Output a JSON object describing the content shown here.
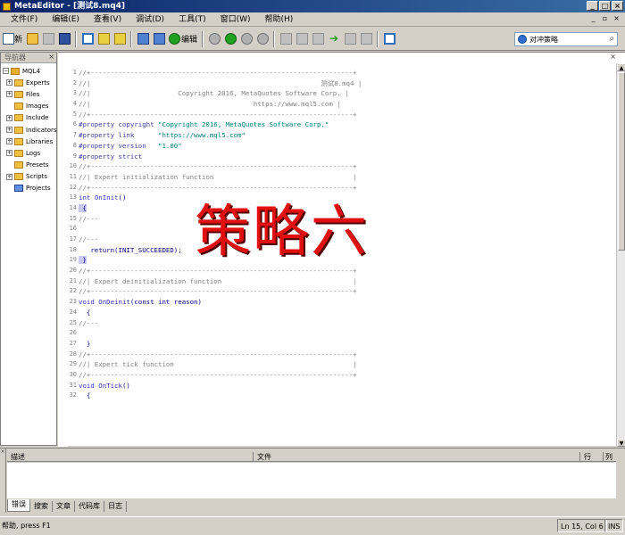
{
  "window": {
    "title": "MetaEditor - [测试8.mq4]"
  },
  "menu": [
    "文件(F)",
    "编辑(E)",
    "查看(V)",
    "调试(D)",
    "工具(T)",
    "窗口(W)",
    "帮助(H)"
  ],
  "toolbar": {
    "new_label": "新",
    "compile_label": "编辑",
    "search_value": "对冲策略"
  },
  "navigator": {
    "header": "导航器",
    "root": "MQL4",
    "items": [
      {
        "label": "Experts",
        "expandable": true
      },
      {
        "label": "Files",
        "expandable": true
      },
      {
        "label": "Images",
        "expandable": false
      },
      {
        "label": "Include",
        "expandable": true
      },
      {
        "label": "Indicators",
        "expandable": true
      },
      {
        "label": "Libraries",
        "expandable": true
      },
      {
        "label": "Logs",
        "expandable": true
      },
      {
        "label": "Presets",
        "expandable": false
      },
      {
        "label": "Scripts",
        "expandable": true
      },
      {
        "label": "Projects",
        "expandable": false
      }
    ]
  },
  "editor": {
    "lines": [
      {
        "n": "1",
        "segs": [
          [
            "c-comment",
            "//+------------------------------------------------------------------+"
          ]
        ]
      },
      {
        "n": "2",
        "segs": [
          [
            "c-comment",
            "//|                                                          测试8.mq4 |"
          ]
        ]
      },
      {
        "n": "3",
        "segs": [
          [
            "c-comment",
            "//|                      Copyright 2016, MetaQuotes Software Corp. |"
          ]
        ]
      },
      {
        "n": "4",
        "segs": [
          [
            "c-comment",
            "//|                                         https://www.mql5.com |"
          ]
        ]
      },
      {
        "n": "5",
        "segs": [
          [
            "c-comment",
            "//+------------------------------------------------------------------+"
          ]
        ]
      },
      {
        "n": "6",
        "segs": [
          [
            "c-pp",
            "#property copyright "
          ],
          [
            "c-str",
            "\"Copyright 2016, MetaQuotes Software Corp.\""
          ]
        ]
      },
      {
        "n": "7",
        "segs": [
          [
            "c-pp",
            "#property link      "
          ],
          [
            "c-str",
            "\"https://www.mql5.com\""
          ]
        ]
      },
      {
        "n": "8",
        "segs": [
          [
            "c-pp",
            "#property version   "
          ],
          [
            "c-str",
            "\"1.00\""
          ]
        ]
      },
      {
        "n": "9",
        "segs": [
          [
            "c-pp",
            "#property strict"
          ]
        ]
      },
      {
        "n": "10",
        "segs": [
          [
            "c-comment",
            "//+------------------------------------------------------------------+"
          ]
        ]
      },
      {
        "n": "11",
        "segs": [
          [
            "c-comment",
            "//| Expert initialization function                                   |"
          ]
        ]
      },
      {
        "n": "12",
        "segs": [
          [
            "c-comment",
            "//+------------------------------------------------------------------+"
          ]
        ]
      },
      {
        "n": "13",
        "segs": [
          [
            "c-kw",
            "int "
          ],
          [
            "c-fn",
            "OnInit"
          ],
          [
            "c-norm",
            "()"
          ]
        ]
      },
      {
        "n": "14",
        "segs": [
          [
            "c-brace bm",
            " {"
          ]
        ]
      },
      {
        "n": "15",
        "segs": [
          [
            "c-comment",
            "//---"
          ]
        ]
      },
      {
        "n": "16",
        "segs": [
          [
            "c-comment",
            ""
          ]
        ]
      },
      {
        "n": "17",
        "segs": [
          [
            "c-comment",
            "//---"
          ]
        ]
      },
      {
        "n": "18",
        "segs": [
          [
            "c-norm",
            "   return(INIT_SUCCEEDED);"
          ]
        ]
      },
      {
        "n": "19",
        "segs": [
          [
            "c-brace bm",
            " }"
          ]
        ]
      },
      {
        "n": "20",
        "segs": [
          [
            "c-comment",
            "//+------------------------------------------------------------------+"
          ]
        ]
      },
      {
        "n": "21",
        "segs": [
          [
            "c-comment",
            "//| Expert deinitialization function                                 |"
          ]
        ]
      },
      {
        "n": "22",
        "segs": [
          [
            "c-comment",
            "//+------------------------------------------------------------------+"
          ]
        ]
      },
      {
        "n": "23",
        "segs": [
          [
            "c-kw",
            "void "
          ],
          [
            "c-fn",
            "OnDeinit"
          ],
          [
            "c-norm",
            "(const int reason)"
          ]
        ]
      },
      {
        "n": "24",
        "segs": [
          [
            "c-brace",
            "  {"
          ]
        ]
      },
      {
        "n": "25",
        "segs": [
          [
            "c-comment",
            "//---"
          ]
        ]
      },
      {
        "n": "26",
        "segs": [
          [
            "c-comment",
            ""
          ]
        ]
      },
      {
        "n": "27",
        "segs": [
          [
            "c-brace",
            "  }"
          ]
        ]
      },
      {
        "n": "28",
        "segs": [
          [
            "c-comment",
            "//+------------------------------------------------------------------+"
          ]
        ]
      },
      {
        "n": "29",
        "segs": [
          [
            "c-comment",
            "//| Expert tick function                                             |"
          ]
        ]
      },
      {
        "n": "30",
        "segs": [
          [
            "c-comment",
            "//+------------------------------------------------------------------+"
          ]
        ]
      },
      {
        "n": "31",
        "segs": [
          [
            "c-kw",
            "void "
          ],
          [
            "c-fn",
            "OnTick"
          ],
          [
            "c-norm",
            "()"
          ]
        ]
      },
      {
        "n": "32",
        "segs": [
          [
            "c-brace",
            "  {"
          ]
        ]
      }
    ],
    "watermark": "策略六"
  },
  "toolbox": {
    "side_label": "工具箱",
    "columns": {
      "desc": "描述",
      "file": "文件",
      "row": "行",
      "col": "列"
    },
    "tabs": [
      "错误",
      "搜索",
      "文章",
      "代码库",
      "日志"
    ]
  },
  "status": {
    "help": "帮助, press F1",
    "position": "Ln 15, Col 6",
    "mode": "INS"
  }
}
